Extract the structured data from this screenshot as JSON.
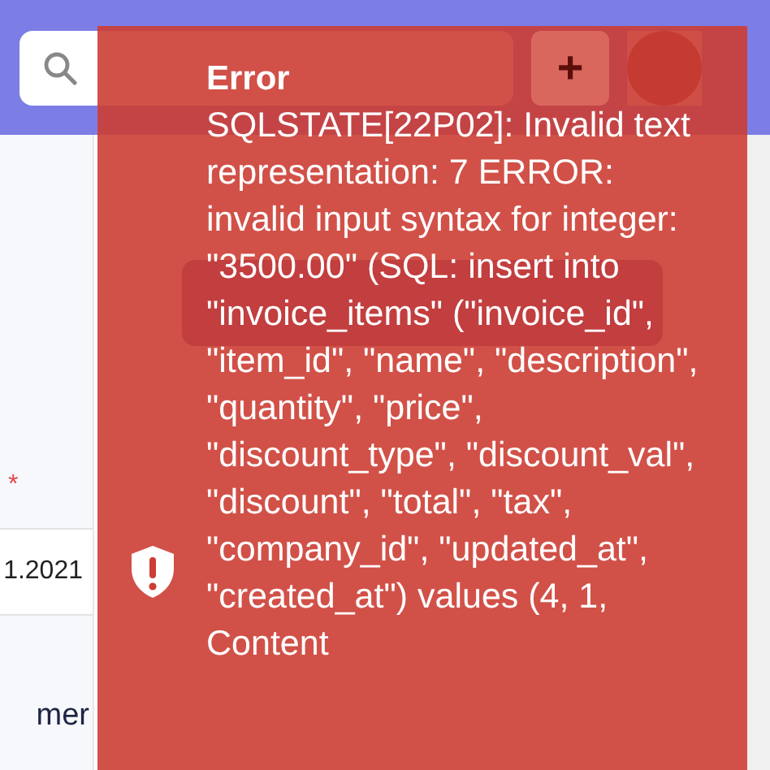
{
  "header": {
    "add_button": {
      "label": "+"
    }
  },
  "form": {
    "required_mark": "*",
    "date_value": "1.2021",
    "label_fragment": "mer"
  },
  "toast": {
    "title": "Error",
    "message": "SQLSTATE[22P02]: Invalid text representation: 7 ERROR: invalid input syntax for integer: \"3500.00\" (SQL: insert into \"invoice_items\" (\"invoice_id\", \"item_id\", \"name\", \"description\", \"quantity\", \"price\", \"discount_type\", \"discount_val\", \"discount\", \"total\", \"tax\", \"company_id\", \"updated_at\", \"created_at\") values (4, 1, Content"
  }
}
